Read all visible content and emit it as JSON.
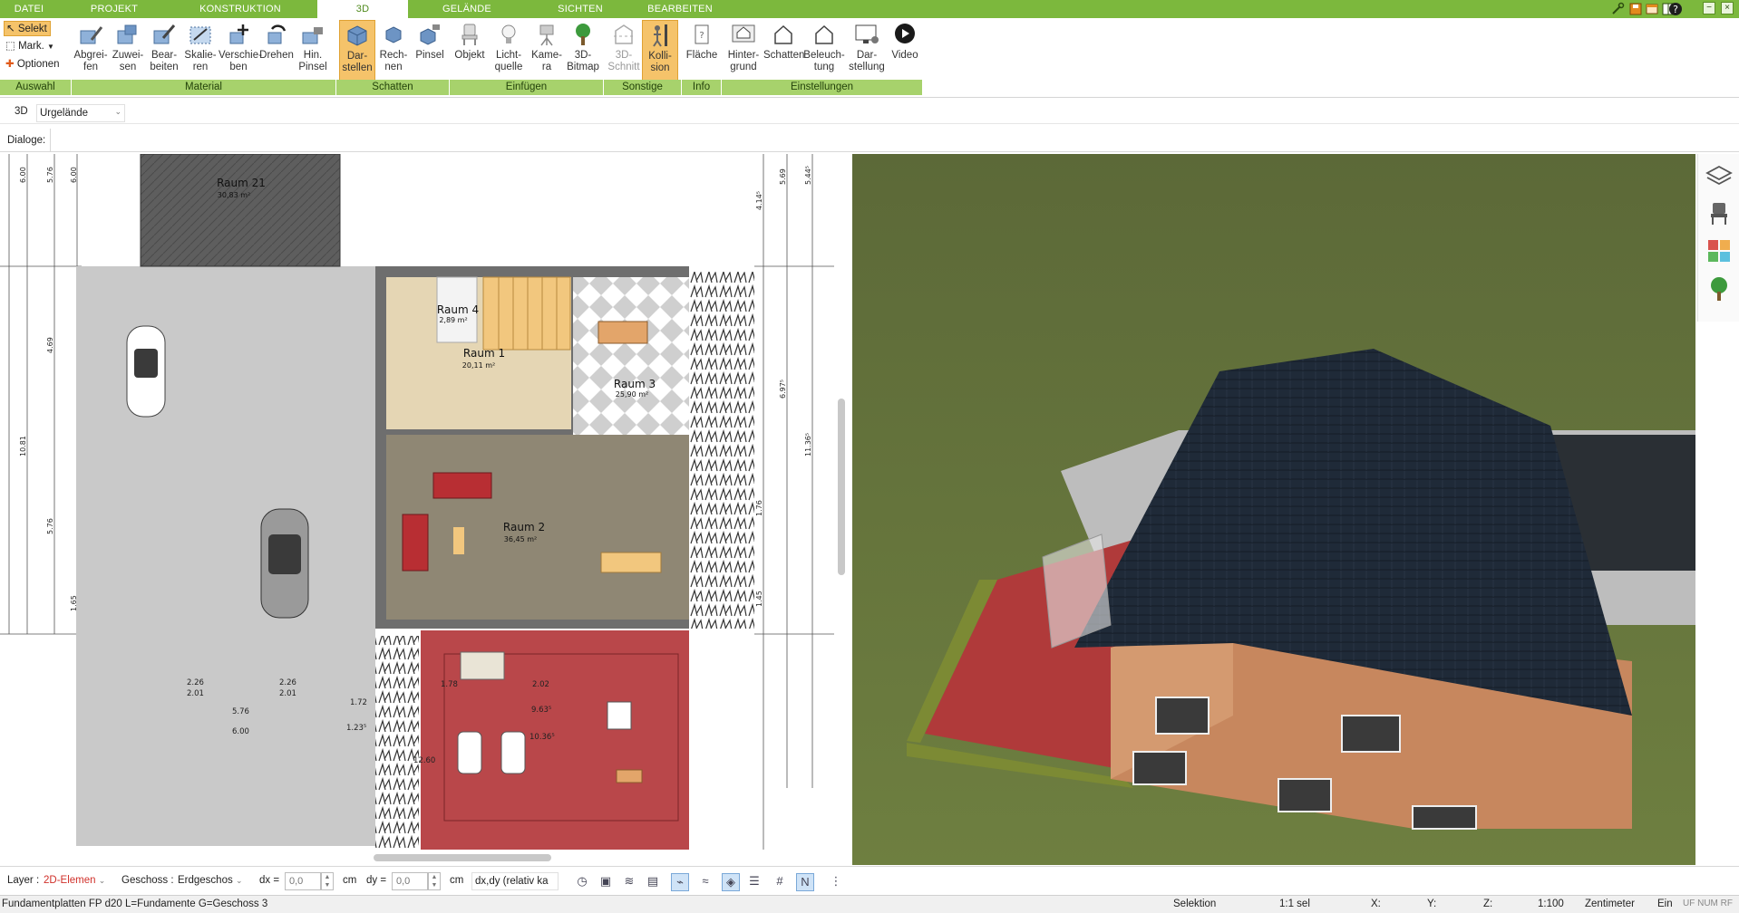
{
  "menu": {
    "tabs": [
      {
        "label": "DATEI",
        "active": false
      },
      {
        "label": "PROJEKT",
        "active": false
      },
      {
        "label": "KONSTRUKTION",
        "active": false
      },
      {
        "label": "3D",
        "active": true
      },
      {
        "label": "GELÄNDE",
        "active": false
      },
      {
        "label": "SICHTEN",
        "active": false
      },
      {
        "label": "BEARBEITEN",
        "active": false
      }
    ],
    "window_buttons": [
      "−",
      "×"
    ]
  },
  "ribbon": {
    "auswahl": {
      "selekt": "Selekt",
      "mark": "Mark.",
      "optionen": "Optionen",
      "group": "Auswahl"
    },
    "material": {
      "group": "Material",
      "buttons": [
        {
          "label": "Abgrei-\nfen",
          "icon": "pipette-icon"
        },
        {
          "label": "Zuwei-\nsen",
          "icon": "assign-icon"
        },
        {
          "label": "Bear-\nbeiten",
          "icon": "edit-material-icon"
        },
        {
          "label": "Skalie-\nren",
          "icon": "scale-icon"
        },
        {
          "label": "Verschie-\nben",
          "icon": "move-icon"
        },
        {
          "label": "Drehen",
          "icon": "rotate-icon"
        },
        {
          "label": "Hin.\nPinsel",
          "icon": "brush-icon"
        }
      ]
    },
    "schatten": {
      "group": "Schatten",
      "buttons": [
        {
          "label": "Dar-\nstellen",
          "icon": "cube-shade-icon",
          "active": true
        },
        {
          "label": "Rech-\nnen",
          "icon": "cube-calc-icon"
        },
        {
          "label": "Pinsel",
          "icon": "cube-brush-icon"
        }
      ]
    },
    "einfuegen": {
      "group": "Einfügen",
      "buttons": [
        {
          "label": "Objekt",
          "icon": "chair-icon"
        },
        {
          "label": "Licht-\nquelle",
          "icon": "bulb-icon"
        },
        {
          "label": "Kame-\nra",
          "icon": "camera-icon"
        },
        {
          "label": "3D-\nBitmap",
          "icon": "tree-icon"
        }
      ]
    },
    "sonstige": {
      "group": "Sonstige",
      "buttons": [
        {
          "label": "3D-\nSchnitt",
          "icon": "cut-icon",
          "disabled": true
        },
        {
          "label": "Kolli-\nsion",
          "icon": "collision-icon",
          "active": true
        }
      ]
    },
    "info": {
      "group": "Info",
      "buttons": [
        {
          "label": "Fläche",
          "icon": "area-icon"
        }
      ]
    },
    "einstellungen": {
      "group": "Einstellungen",
      "buttons": [
        {
          "label": "Hinter-\ngrund",
          "icon": "background-icon"
        },
        {
          "label": "Schatten",
          "icon": "house-shadow-icon"
        },
        {
          "label": "Beleuch-\ntung",
          "icon": "house-light-icon"
        },
        {
          "label": "Dar-\nstellung",
          "icon": "display-icon"
        },
        {
          "label": "Video",
          "icon": "play-icon"
        }
      ]
    }
  },
  "viewbar": {
    "mode": "3D",
    "terrain": "Urgelände"
  },
  "dialogbar": {
    "label": "Dialoge:"
  },
  "plan": {
    "rooms": [
      {
        "name": "Raum 21",
        "area": "30,83 m²"
      },
      {
        "name": "Raum 4",
        "area": "2,89 m²"
      },
      {
        "name": "Raum 1",
        "area": "20,11 m²"
      },
      {
        "name": "Raum 3",
        "area": "25,90 m²"
      },
      {
        "name": "Raum 2",
        "area": "36,45 m²"
      }
    ],
    "dims_left": [
      "6.00",
      "5.76",
      "6.00",
      "4.69",
      "10.81",
      "5.76",
      "1.65"
    ],
    "dims_right": [
      "5.44⁵",
      "5.69",
      "4.14⁵",
      "11.36⁵",
      "6.97⁵",
      "1.76",
      "1.45"
    ],
    "dims_bottom": [
      "2.26",
      "2.01",
      "2.26",
      "2.01",
      "1.72",
      "6.00",
      "5.76",
      "1.23⁵",
      "1.78",
      "2.02",
      "9.63⁵",
      "10.36⁵",
      "12.60"
    ]
  },
  "bottom": {
    "layer_label": "Layer :",
    "layer_value": "2D-Elemen",
    "geschoss_label": "Geschoss :",
    "geschoss_value": "Erdgeschos",
    "dx_label": "dx =",
    "dx_value": "0,0",
    "dy_label": "dy =",
    "dy_value": "0,0",
    "unit": "cm",
    "mode_value": "dx,dy (relativ ka"
  },
  "status": {
    "hint": "Fundamentplatten FP d20 L=Fundamente G=Geschoss 3",
    "mode": "Selektion",
    "sel": "1:1 sel",
    "x": "X:",
    "y": "Y:",
    "z": "Z:",
    "scale": "1:100",
    "unit": "Zentimeter",
    "ein": "Ein",
    "flags": "UF NUM RF"
  },
  "colors": {
    "accent": "#7cb83d",
    "group_bg": "#a7d26c",
    "active": "#f5c36a"
  }
}
